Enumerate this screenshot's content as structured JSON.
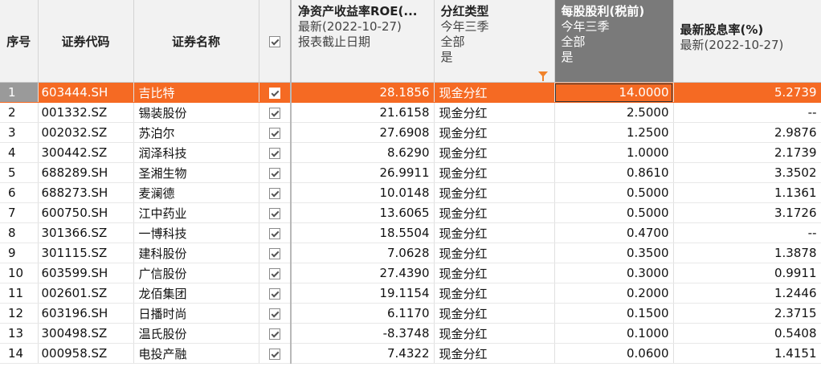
{
  "columns": {
    "seq": "序号",
    "code": "证券代码",
    "name": "证券名称",
    "roe": {
      "title": "净资产收益率ROE(...",
      "line1": "最新(2022-10-27)",
      "line2": "报表截止日期"
    },
    "div_type": {
      "title": "分红类型",
      "line1": "今年三季",
      "line2": "全部",
      "line3": "是"
    },
    "dps": {
      "title": "每股股利(税前)",
      "line1": "今年三季",
      "line2": "全部",
      "line3": "是"
    },
    "yield": {
      "title": "最新股息率(%)",
      "line1": "最新(2022-10-27)"
    }
  },
  "rows": [
    {
      "seq": "1",
      "code": "603444.SH",
      "name": "吉比特",
      "roe": "28.1856",
      "type": "现金分红",
      "dps": "14.0000",
      "yield": "5.2739"
    },
    {
      "seq": "2",
      "code": "001332.SZ",
      "name": "锡装股份",
      "roe": "21.6158",
      "type": "现金分红",
      "dps": "2.5000",
      "yield": "--"
    },
    {
      "seq": "3",
      "code": "002032.SZ",
      "name": "苏泊尔",
      "roe": "27.6908",
      "type": "现金分红",
      "dps": "1.2500",
      "yield": "2.9876"
    },
    {
      "seq": "4",
      "code": "300442.SZ",
      "name": "润泽科技",
      "roe": "8.6290",
      "type": "现金分红",
      "dps": "1.0000",
      "yield": "2.1739"
    },
    {
      "seq": "5",
      "code": "688289.SH",
      "name": "圣湘生物",
      "roe": "26.9911",
      "type": "现金分红",
      "dps": "0.8610",
      "yield": "3.3502"
    },
    {
      "seq": "6",
      "code": "688273.SH",
      "name": "麦澜德",
      "roe": "10.0148",
      "type": "现金分红",
      "dps": "0.5000",
      "yield": "1.1361"
    },
    {
      "seq": "7",
      "code": "600750.SH",
      "name": "江中药业",
      "roe": "13.6065",
      "type": "现金分红",
      "dps": "0.5000",
      "yield": "3.1726"
    },
    {
      "seq": "8",
      "code": "301366.SZ",
      "name": "一博科技",
      "roe": "18.5504",
      "type": "现金分红",
      "dps": "0.4700",
      "yield": "--"
    },
    {
      "seq": "9",
      "code": "301115.SZ",
      "name": "建科股份",
      "roe": "7.0628",
      "type": "现金分红",
      "dps": "0.3500",
      "yield": "1.3878"
    },
    {
      "seq": "10",
      "code": "603599.SH",
      "name": "广信股份",
      "roe": "27.4390",
      "type": "现金分红",
      "dps": "0.3000",
      "yield": "0.9911"
    },
    {
      "seq": "11",
      "code": "002601.SZ",
      "name": "龙佰集团",
      "roe": "19.1154",
      "type": "现金分红",
      "dps": "0.2000",
      "yield": "1.2446"
    },
    {
      "seq": "12",
      "code": "603196.SH",
      "name": "日播时尚",
      "roe": "6.1170",
      "type": "现金分红",
      "dps": "0.1500",
      "yield": "2.3715"
    },
    {
      "seq": "13",
      "code": "300498.SZ",
      "name": "温氏股份",
      "roe": "-8.3748",
      "type": "现金分红",
      "dps": "0.1000",
      "yield": "0.5408"
    },
    {
      "seq": "14",
      "code": "000958.SZ",
      "name": "电投产融",
      "roe": "7.4322",
      "type": "现金分红",
      "dps": "0.0600",
      "yield": "1.4151"
    }
  ],
  "colors": {
    "accent": "#f56a23",
    "header_bg": "#f2f2f2",
    "selected_header_bg": "#7a7a7a",
    "filter_icon": "#f0822a"
  },
  "icons": {
    "checkbox": "checkbox-checked-icon",
    "filter": "filter-icon"
  }
}
